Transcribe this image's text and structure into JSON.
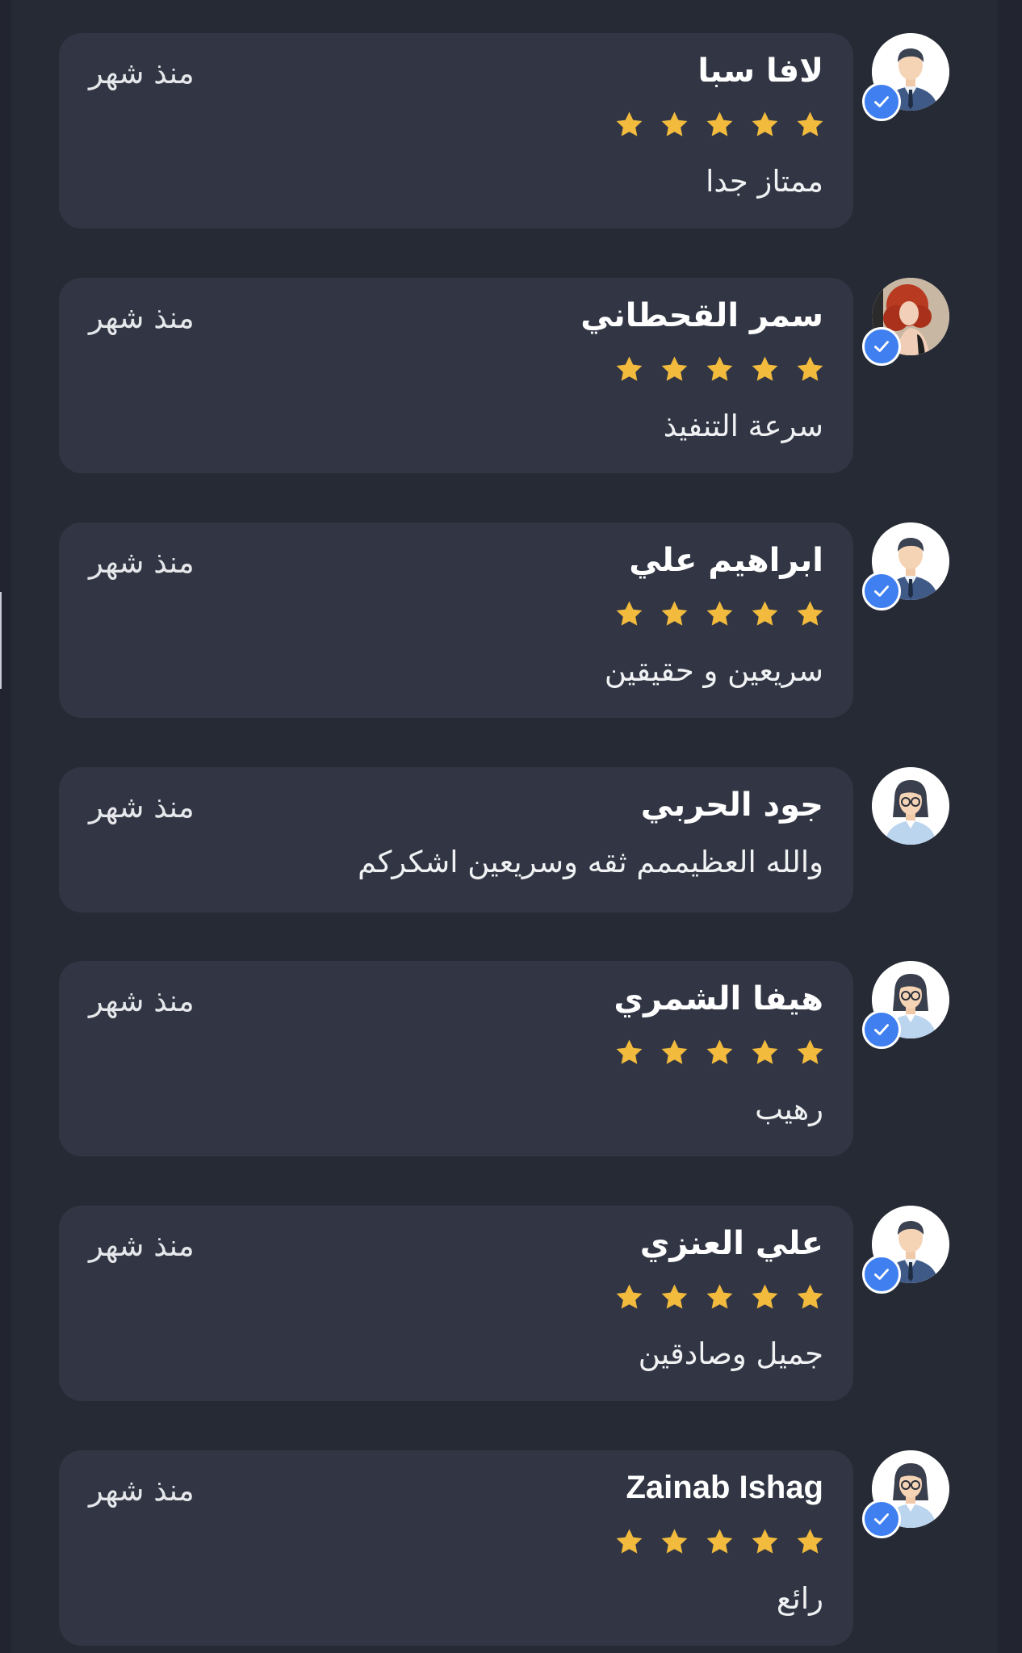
{
  "colors": {
    "background": "#22252f",
    "card": "#323644",
    "star": "#f2bb3d",
    "verified_badge": "#3f7ff0"
  },
  "reviews": [
    {
      "name": "لافا سبا",
      "time": "منذ شهر",
      "rating": 5,
      "comment": "ممتاز جدا",
      "verified": true,
      "avatar": "man-avatar-icon"
    },
    {
      "name": "سمر القحطاني",
      "time": "منذ شهر",
      "rating": 5,
      "comment": "سرعة التنفيذ",
      "verified": true,
      "avatar": "woman-photo-avatar"
    },
    {
      "name": "ابراهيم علي",
      "time": "منذ شهر",
      "rating": 5,
      "comment": "سريعين و حقيقين",
      "verified": true,
      "avatar": "man-avatar-icon"
    },
    {
      "name": "جود الحربي",
      "time": "منذ شهر",
      "rating": 0,
      "comment": "والله العظيممم ثقه وسريعين اشكركم",
      "verified": false,
      "avatar": "woman-glasses-avatar-icon"
    },
    {
      "name": "هيفا الشمري",
      "time": "منذ شهر",
      "rating": 5,
      "comment": "رهيب",
      "verified": true,
      "avatar": "woman-glasses-avatar-icon"
    },
    {
      "name": "علي العنزي",
      "time": "منذ شهر",
      "rating": 5,
      "comment": "جميل وصادقين",
      "verified": true,
      "avatar": "man-avatar-icon"
    },
    {
      "name": "Zainab Ishag",
      "time": "منذ شهر",
      "rating": 5,
      "comment": "رائع",
      "verified": true,
      "avatar": "woman-glasses-avatar-icon"
    }
  ]
}
